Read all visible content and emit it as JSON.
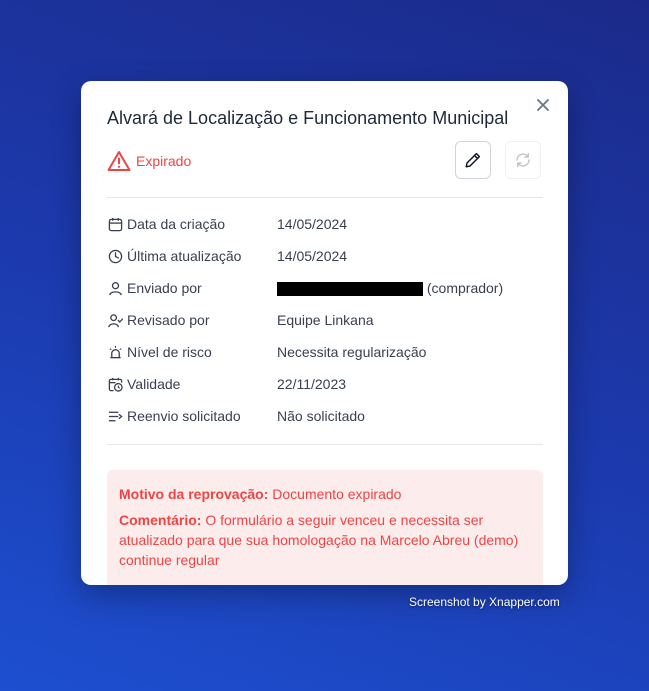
{
  "modal": {
    "title": "Alvará de Localização e Funcionamento Municipal",
    "status": {
      "label": "Expirado",
      "icon": "warning-triangle-icon",
      "color": "#ef4444"
    },
    "buttons": {
      "edit_icon": "pencil-icon",
      "refresh_icon": "refresh-icon"
    },
    "details": [
      {
        "icon": "calendar-icon",
        "label": "Data da criação",
        "value": "14/05/2024"
      },
      {
        "icon": "clock-icon",
        "label": "Última atualização",
        "value": "14/05/2024"
      },
      {
        "icon": "user-icon",
        "label": "Enviado por",
        "value": "(comprador)"
      },
      {
        "icon": "user-check-icon",
        "label": "Revisado por",
        "value": "Equipe Linkana"
      },
      {
        "icon": "siren-icon",
        "label": "Nível de risco",
        "value": "Necessita regularização"
      },
      {
        "icon": "calendar-clock-icon",
        "label": "Validade",
        "value": "22/11/2023"
      },
      {
        "icon": "list-arrow-icon",
        "label": "Reenvio solicitado",
        "value": "Não solicitado"
      }
    ],
    "alert": {
      "reason_label": "Motivo da reprovação:",
      "reason_value": "Documento expirado",
      "comment_label": "Comentário:",
      "comment_value": "O formulário a seguir venceu e necessita ser atualizado para que sua homologação na Marcelo Abreu (demo) continue regular"
    }
  },
  "watermark": "Screenshot by Xnapper.com"
}
